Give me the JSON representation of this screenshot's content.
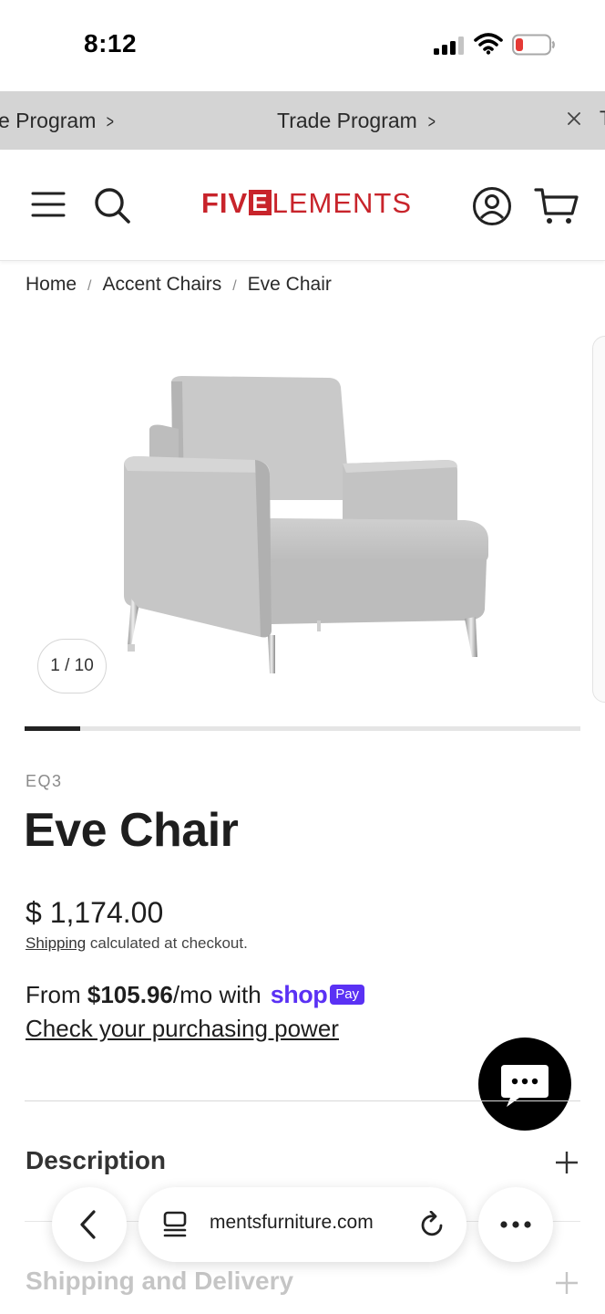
{
  "status_bar": {
    "time": "8:12"
  },
  "announcement": {
    "items": [
      {
        "label": "e Program"
      },
      {
        "label": "Trade Program"
      }
    ],
    "peek": "T"
  },
  "header": {
    "logo": {
      "part1": "FIV",
      "part2": "E",
      "part3": "LEMENTS"
    }
  },
  "breadcrumb": {
    "items": [
      "Home",
      "Accent Chairs",
      "Eve Chair"
    ],
    "separator": "/"
  },
  "gallery": {
    "counter": "1 / 10",
    "current": 1,
    "total": 10,
    "progress_fraction": 0.1
  },
  "product": {
    "vendor": "EQ3",
    "title": "Eve Chair",
    "price": "$ 1,174.00",
    "shipping_link": "Shipping",
    "shipping_note": " calculated at checkout."
  },
  "installments": {
    "prefix": "From ",
    "amount": "$105.96",
    "suffix": "/mo with",
    "shop_brand": "shop",
    "pay_badge": "Pay",
    "power_link": "Check your purchasing power"
  },
  "accordion": [
    {
      "title": "Description"
    },
    {
      "title": "Shipping and Delivery"
    }
  ],
  "browser": {
    "url": "mentsfurniture.com"
  },
  "colors": {
    "brand_red": "#c8242b",
    "shop_pay_purple": "#5a31f4",
    "announcement_bg": "#d4d4d4"
  },
  "icons": [
    "signal-icon",
    "wifi-icon",
    "battery-icon",
    "chevron-right-icon",
    "close-icon",
    "menu-icon",
    "search-icon",
    "account-icon",
    "cart-icon",
    "chat-icon",
    "plus-icon",
    "back-icon",
    "tabs-icon",
    "reload-icon",
    "more-icon"
  ]
}
